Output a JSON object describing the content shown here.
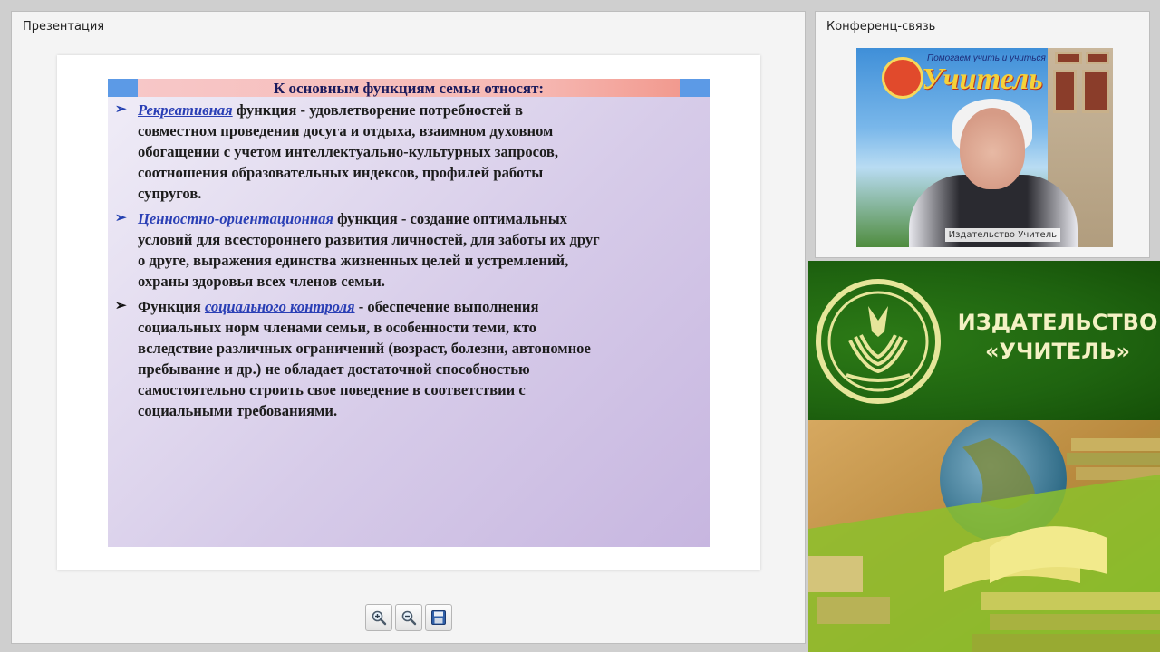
{
  "presentation": {
    "title": "Презентация",
    "slide": {
      "title": "К основным функциям семьи относят:",
      "bullets": [
        {
          "term": "Рекреативная",
          "lines": [
            "функция - удовлетворение потребностей в",
            "совместном проведении досуга и отдыха, взаимном духовном",
            "обогащении с учетом интеллектуально-культурных запросов,",
            "соотношения образовательных индексов, профилей работы",
            "супругов."
          ]
        },
        {
          "term": "Ценностно-ориентационная",
          "lines": [
            "функция - создание оптимальных",
            "условий для всестороннего развития личностей, для заботы их друг",
            "о друге, выражения единства жизненных целей и устремлений,",
            "охраны здоровья всех членов семьи."
          ]
        },
        {
          "prefix": "Функция",
          "term": "социального контроля",
          "lines": [
            "- обеспечение выполнения",
            "социальных норм членами семьи, в особенности теми, кто",
            "вследствие различных ограничений (возраст, болезни, автономное",
            "пребывание и др.) не обладает достаточной способностью",
            "самостоятельно строить свое поведение в соответствии с",
            "социальными требованиями."
          ]
        }
      ]
    },
    "toolbar": {
      "zoom_in_icon": "zoom-in-icon",
      "zoom_out_icon": "zoom-out-icon",
      "save_icon": "save-icon"
    }
  },
  "conference": {
    "title": "Конференц-связь",
    "video": {
      "caption": "Издательство Учитель",
      "banner_line": "Помогаем учить и учиться",
      "logo_text": "Учитель"
    }
  },
  "publisher": {
    "name_line1": "ИЗДАТЕЛЬСТВО",
    "name_line2": "«УЧИТЕЛЬ»"
  },
  "colors": {
    "term": "#2a3fb5",
    "publisher_green": "#1f6410",
    "publisher_text": "#f4f1c4"
  }
}
